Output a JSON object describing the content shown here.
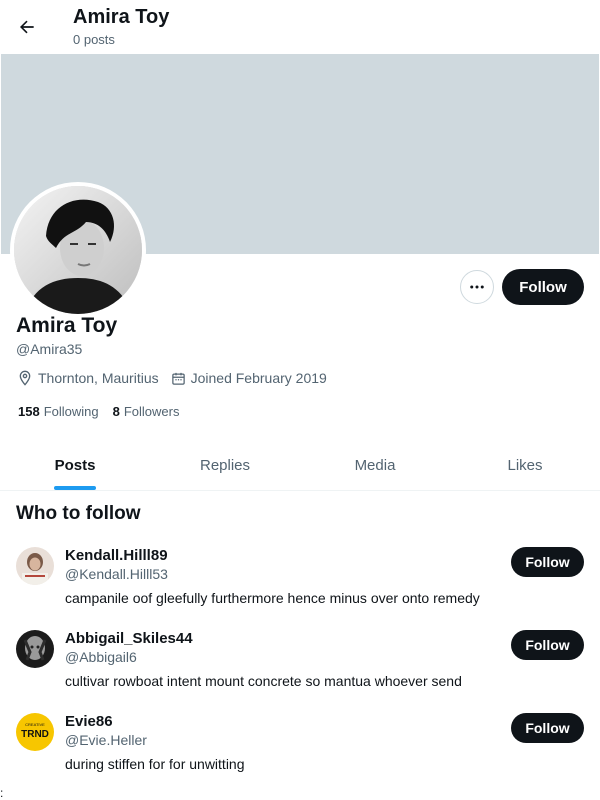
{
  "topbar": {
    "title": "Amira Toy",
    "subtitle": "0 posts",
    "back_icon": "arrow-left-icon"
  },
  "profile": {
    "name": "Amira Toy",
    "handle": "@Amira35",
    "location": "Thornton, Mauritius",
    "joined": "Joined February 2019",
    "following_count": "158",
    "following_label": "Following",
    "followers_count": "8",
    "followers_label": "Followers",
    "follow_label": "Follow",
    "banner_color": "#cfd9de"
  },
  "tabs": [
    {
      "label": "Posts",
      "active": true
    },
    {
      "label": "Replies",
      "active": false
    },
    {
      "label": "Media",
      "active": false
    },
    {
      "label": "Likes",
      "active": false
    }
  ],
  "who_to_follow": {
    "title": "Who to follow",
    "items": [
      {
        "name": "Kendall.Hilll89",
        "handle": "@Kendall.Hilll53",
        "bio": "campanile oof gleefully furthermore hence minus over onto remedy",
        "follow_label": "Follow"
      },
      {
        "name": "Abbigail_Skiles44",
        "handle": "@Abbigail6",
        "bio": "cultivar rowboat intent mount concrete so mantua whoever send",
        "follow_label": "Follow"
      },
      {
        "name": "Evie86",
        "handle": "@Evie.Heller",
        "bio": "during stiffen for for unwitting",
        "follow_label": "Follow",
        "avatar_text": "TRND",
        "avatar_small": "CREATIVE"
      }
    ]
  },
  "edge_mark": ":",
  "colors": {
    "accent": "#1d9bf0",
    "text": "#0f1419",
    "muted": "#536471",
    "button": "#0f1419"
  }
}
